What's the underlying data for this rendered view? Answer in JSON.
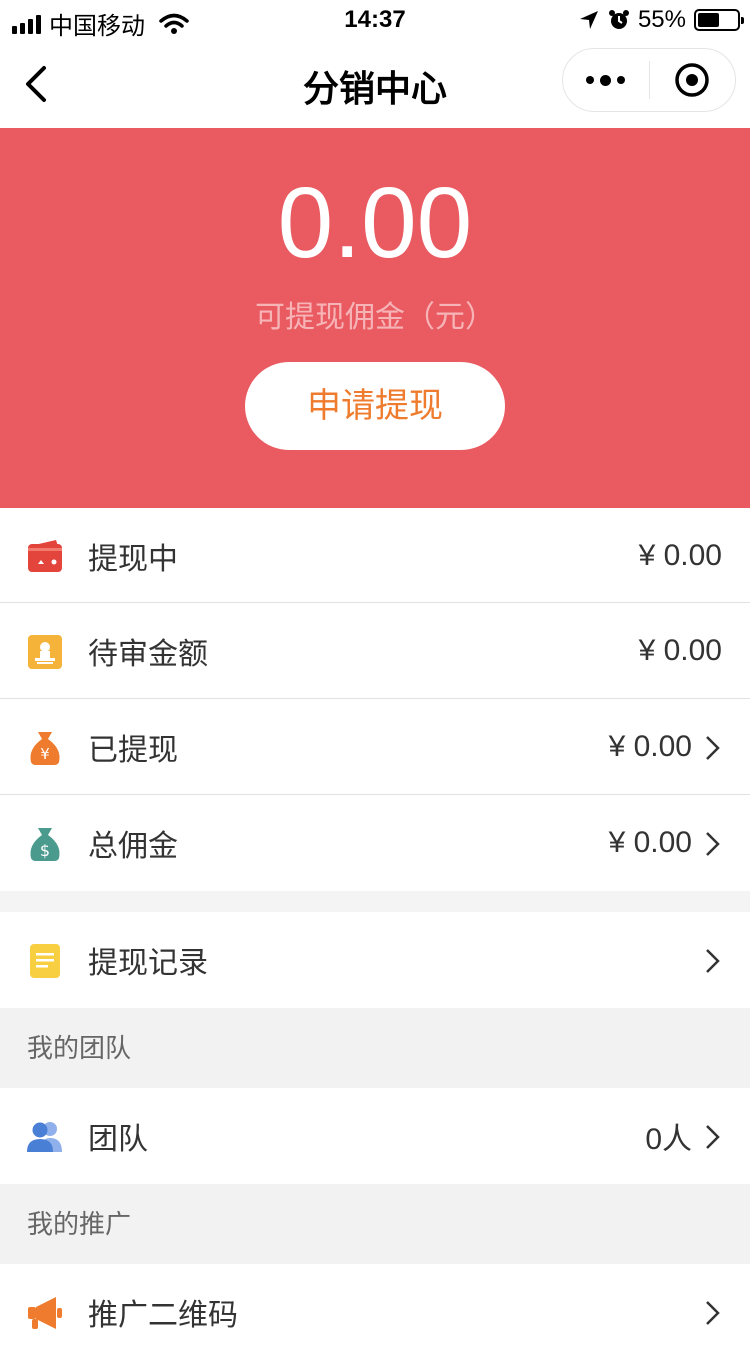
{
  "status_bar": {
    "carrier": "中国移动",
    "time": "14:37",
    "battery": "55%",
    "battery_level": 0.55
  },
  "nav": {
    "title": "分销中心"
  },
  "hero": {
    "amount": "0.00",
    "amount_label": "可提现佣金（元）",
    "button_label": "申请提现"
  },
  "rows": [
    {
      "label": "提现中",
      "value": "¥ 0.00",
      "icon": "wallet-icon",
      "color": "#e3443c"
    },
    {
      "label": "待审金额",
      "value": "¥ 0.00",
      "icon": "audit-stamp-icon",
      "color": "#f5b33a"
    },
    {
      "label": "已提现",
      "value": "¥ 0.00",
      "icon": "money-bag-yuan-icon",
      "color": "#ef7c2e"
    },
    {
      "label": "总佣金",
      "value": "¥ 0.00",
      "icon": "money-bag-dollar-icon",
      "color": "#4a9a8e"
    }
  ],
  "record": {
    "label": "提现记录",
    "icon": "document-icon",
    "color": "#f7cf40"
  },
  "team_section": {
    "title": "我的团队"
  },
  "team": {
    "label": "团队",
    "value": "0人",
    "icon": "team-icon",
    "color": "#4a7fd6"
  },
  "promo_section": {
    "title": "我的推广"
  },
  "promo": {
    "label": "推广二维码",
    "icon": "megaphone-icon",
    "color": "#ef7c2e"
  }
}
